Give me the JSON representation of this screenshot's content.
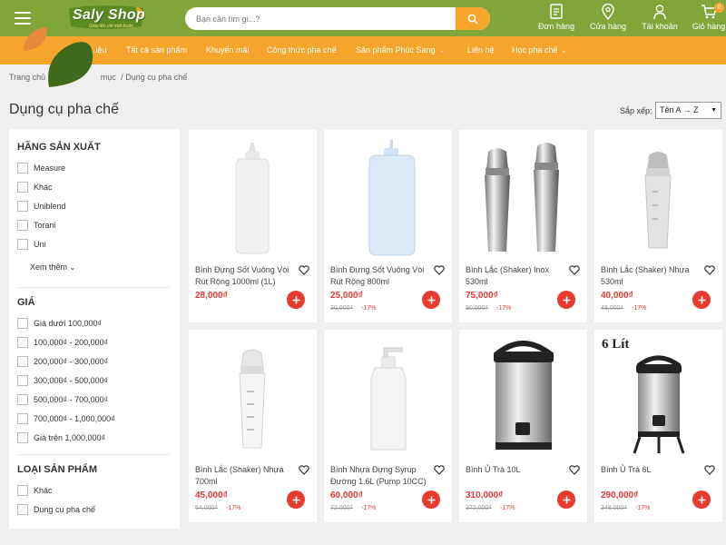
{
  "header": {
    "logo_text": "Saly Shop",
    "logo_tagline": "Giàu lên chỉ một bước",
    "search_placeholder": "Bạn cần tìm gì...?",
    "orders_label": "Đơn hàng",
    "stores_label": "Cửa hàng",
    "account_label": "Tài khoản",
    "cart_label": "Giỏ hàng",
    "cart_count": "0"
  },
  "nav": {
    "items": [
      {
        "label": "...iệu",
        "has_chevron": false
      },
      {
        "label": "Tất cả sản phẩm",
        "has_chevron": false
      },
      {
        "label": "Khuyến mãi",
        "has_chevron": false
      },
      {
        "label": "Công thức pha chế",
        "has_chevron": false
      },
      {
        "label": "Sản phẩm Phúc Sang",
        "has_chevron": true
      },
      {
        "label": "Liên hệ",
        "has_chevron": false
      },
      {
        "label": "Học pha chế",
        "has_chevron": true
      }
    ]
  },
  "breadcrumb": {
    "home": "Trang chủ",
    "middle": "mục",
    "current": "/ Dụng cụ pha chế"
  },
  "page": {
    "title": "Dụng cụ pha chế",
    "sort_label": "Sắp xếp:",
    "sort_value": "Tên A → Z"
  },
  "sidebar": {
    "manufacturer_title": "Hãng sản xuất",
    "manufacturers": [
      "Measure",
      "Khác",
      "Uniblend",
      "Torani",
      "Uni"
    ],
    "see_more": "Xem thêm",
    "price_title": "Giá",
    "prices": [
      "Giá dưới 100,000₫",
      "100,000₫ - 200,000₫",
      "200,000₫ - 300,000₫",
      "300,000₫ - 500,000₫",
      "500,000₫ - 700,000₫",
      "700,000₫ - 1,000,000₫",
      "Giá trên 1,000,000₫"
    ],
    "type_title": "Loại sản phẩm",
    "types": [
      "Khác",
      "Dụng cụ pha chế"
    ]
  },
  "products": [
    {
      "name": "Bình Đựng Sốt Vuông Vòi Rút Rộng 1000ml (1L)",
      "price": "28,000₫",
      "old_price": "",
      "discount": "",
      "image": "bottle-white-icon"
    },
    {
      "name": "Bình Đựng Sốt Vuông Vòi Rút Rộng 800ml",
      "price": "25,000₫",
      "old_price": "30,000₫",
      "discount": "-17%",
      "image": "bottle-blue-icon"
    },
    {
      "name": "Bình Lắc (Shaker) Inox 530ml",
      "price": "75,000₫",
      "old_price": "90,000₫",
      "discount": "-17%",
      "image": "shaker-steel-icon"
    },
    {
      "name": "Bình Lắc (Shaker) Nhựa 530ml",
      "price": "40,000₫",
      "old_price": "48,000₫",
      "discount": "-17%",
      "image": "shaker-plastic-icon"
    },
    {
      "name": "Bình Lắc (Shaker) Nhựa 700ml",
      "price": "45,000₫",
      "old_price": "54,000₫",
      "discount": "-17%",
      "image": "shaker-clear-icon"
    },
    {
      "name": "Bình Nhựa Đựng Syrup Đường 1.6L (Pump 10CC)",
      "price": "60,000₫",
      "old_price": "72,000₫",
      "discount": "-17%",
      "image": "pump-bottle-icon"
    },
    {
      "name": "Bình Ủ Trà 10L",
      "price": "310,000₫",
      "old_price": "372,000₫",
      "discount": "-17%",
      "image": "tea-urn-icon"
    },
    {
      "name": "Bình Ủ Trà 6L",
      "price": "290,000₫",
      "old_price": "348,000₫",
      "discount": "-17%",
      "image": "tea-urn-icon",
      "image_caption": "6 Lít"
    }
  ],
  "colors": {
    "header_green": "#80a63a",
    "nav_orange": "#f6a52c",
    "price_red": "#e03a32",
    "add_red": "#e63b2e"
  }
}
